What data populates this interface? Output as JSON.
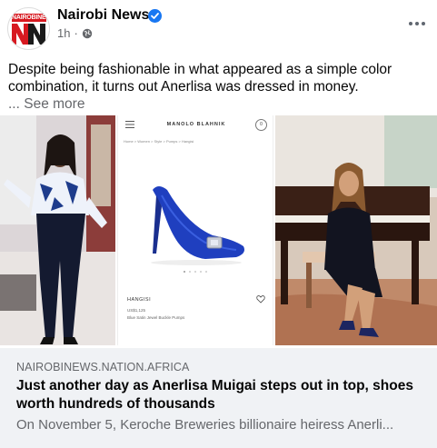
{
  "post": {
    "page_name": "Nairobi News",
    "verified_icon": "verified-badge-icon",
    "time": "1h",
    "separator": "·",
    "audience_icon": "globe-icon",
    "caption": "Despite being fashionable in what appeared as a simple color combination, it turns out Anerlisa was dressed in money.",
    "see_more_prefix": "...",
    "see_more": "See more",
    "more_icon": "more-options-icon"
  },
  "avatar": {
    "logo_text": "NAIROBINEWS"
  },
  "images": {
    "product_page": {
      "brand": "MANOLO BLAHNIK",
      "breadcrumb": "Home  >  Women  >  Style  >  Pumps  >  Hangisi",
      "product_name": "HANGISI",
      "price": "US$1,125",
      "subtitle": "Blue Satin Jewel Buckle Pumps",
      "bag_count": "0"
    }
  },
  "link_preview": {
    "domain": "NAIROBINEWS.NATION.AFRICA",
    "headline": "Just another day as Anerlisa Muigai steps out in top, shoes worth hundreds of thousands",
    "description": "On November 5, Keroche Breweries billionaire heiress Anerli..."
  },
  "colors": {
    "brand_red": "#d71920",
    "verified_blue": "#1877f2",
    "link_bg": "#f0f2f5",
    "meta_gray": "#65676b"
  }
}
